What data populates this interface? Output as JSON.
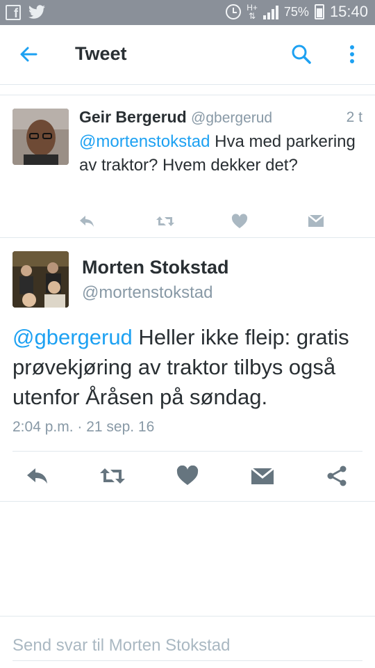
{
  "status_bar": {
    "icons": [
      "facebook-icon",
      "twitter-icon",
      "alarm-icon",
      "network-icon",
      "signal-icon",
      "battery-icon"
    ],
    "network": "H+",
    "battery": "75%",
    "time": "15:40"
  },
  "app_bar": {
    "title": "Tweet"
  },
  "reply_tweet": {
    "name": "Geir Bergerud",
    "handle": "@gbergerud",
    "time": "2 t",
    "mention": "@mortenstokstad",
    "text": " Hva med parkering av traktor? Hvem dekker det?"
  },
  "main_tweet": {
    "name": "Morten Stokstad",
    "handle": "@mortenstokstad",
    "mention": "@gbergerud",
    "text": " Heller ikke fleip: gratis prøvekjøring av traktor tilbys også utenfor Åråsen på søndag.",
    "timestamp": "2:04 p.m. · 21 sep. 16"
  },
  "composer": {
    "placeholder": "Send svar til Morten Stokstad"
  },
  "colors": {
    "accent": "#1da1f2",
    "status_bar": "#8a9099",
    "secondary_text": "#8899a6",
    "icon_gray": "#aab8c2",
    "action_gray": "#66757f"
  }
}
